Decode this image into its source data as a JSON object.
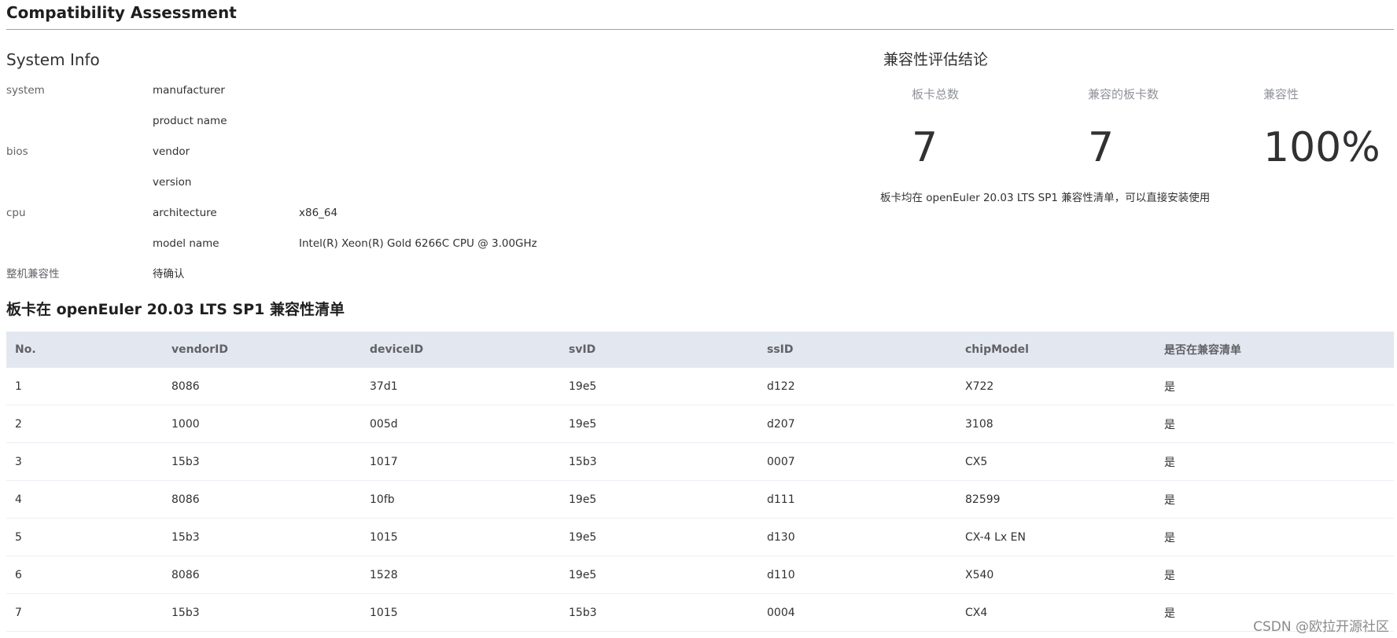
{
  "page_title": "Compatibility Assessment",
  "system_info": {
    "title": "System Info",
    "rows": [
      {
        "c1": "system",
        "c2": "manufacturer",
        "c3": ""
      },
      {
        "c1": "",
        "c2": "product name",
        "c3": ""
      },
      {
        "c1": "bios",
        "c2": "vendor",
        "c3": ""
      },
      {
        "c1": "",
        "c2": "version",
        "c3": ""
      },
      {
        "c1": "cpu",
        "c2": "architecture",
        "c3": "x86_64"
      },
      {
        "c1": "",
        "c2": "model name",
        "c3": "Intel(R) Xeon(R) Gold 6266C CPU @ 3.00GHz"
      },
      {
        "c1": "整机兼容性",
        "c2": "待确认",
        "c3": ""
      }
    ]
  },
  "conclusion": {
    "title": "兼容性评估结论",
    "stats": [
      {
        "label": "板卡总数",
        "value": "7"
      },
      {
        "label": "兼容的板卡数",
        "value": "7"
      },
      {
        "label": "兼容性",
        "value": "100%"
      }
    ],
    "note": "板卡均在 openEuler 20.03 LTS SP1 兼容性清单，可以直接安装使用"
  },
  "card_list": {
    "title": "板卡在 openEuler 20.03 LTS SP1 兼容性清单",
    "columns": [
      "No.",
      "vendorID",
      "deviceID",
      "svID",
      "ssID",
      "chipModel",
      "是否在兼容清单"
    ],
    "rows": [
      [
        "1",
        "8086",
        "37d1",
        "19e5",
        "d122",
        "X722",
        "是"
      ],
      [
        "2",
        "1000",
        "005d",
        "19e5",
        "d207",
        "3108",
        "是"
      ],
      [
        "3",
        "15b3",
        "1017",
        "15b3",
        "0007",
        "CX5",
        "是"
      ],
      [
        "4",
        "8086",
        "10fb",
        "19e5",
        "d111",
        "82599",
        "是"
      ],
      [
        "5",
        "15b3",
        "1015",
        "19e5",
        "d130",
        "CX-4 Lx EN",
        "是"
      ],
      [
        "6",
        "8086",
        "1528",
        "19e5",
        "d110",
        "X540",
        "是"
      ],
      [
        "7",
        "15b3",
        "1015",
        "15b3",
        "0004",
        "CX4",
        "是"
      ]
    ]
  },
  "watermark": "CSDN @欧拉开源社区"
}
